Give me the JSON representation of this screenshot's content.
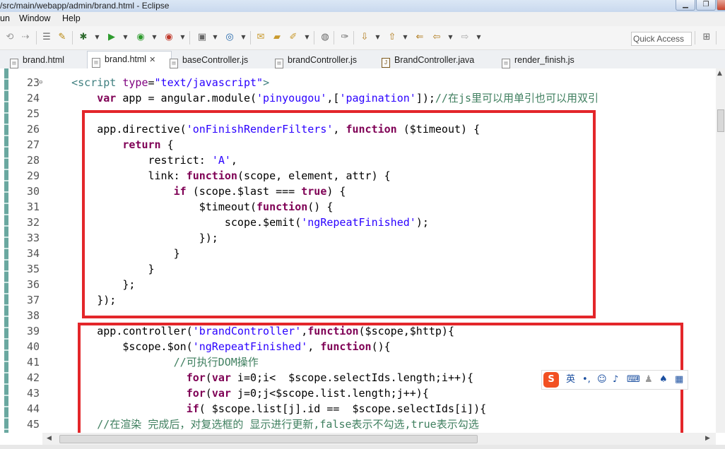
{
  "window": {
    "title": "/src/main/webapp/admin/brand.html - Eclipse"
  },
  "menu": [
    "un",
    "Window",
    "Help"
  ],
  "quick_access": "Quick Access",
  "tabs": [
    {
      "label": "brand.html"
    },
    {
      "label": "brand.html",
      "close": "✕",
      "active": true
    },
    {
      "label": "baseController.js"
    },
    {
      "label": "brandController.js"
    },
    {
      "label": "BrandController.java"
    },
    {
      "label": "render_finish.js"
    }
  ],
  "ime": {
    "logo": "S",
    "label": "英"
  },
  "code_lines": [
    {
      "n": "23",
      "fold": "⊖",
      "code": [
        [
          "tag",
          "<"
        ],
        [
          "tag",
          "script "
        ],
        [
          "att",
          "type"
        ],
        [
          "",
          "="
        ],
        [
          "str",
          "\"text/javascript\""
        ],
        [
          "tag",
          ">"
        ]
      ],
      "indent": "    "
    },
    {
      "n": "24",
      "code": [
        [
          "kw",
          "var"
        ],
        [
          "",
          " app = angular.module("
        ],
        [
          "str",
          "'pinyougou'"
        ],
        [
          "",
          ",["
        ],
        [
          "str",
          "'pagination'"
        ],
        [
          "",
          "]);"
        ],
        [
          "com",
          "//在js里可以用单引也可以用双引"
        ]
      ],
      "indent": "        "
    },
    {
      "n": "25",
      "code": [],
      "indent": ""
    },
    {
      "n": "26",
      "code": [
        [
          "",
          "app.directive("
        ],
        [
          "str",
          "'onFinishRenderFilters'"
        ],
        [
          "",
          ", "
        ],
        [
          "kw",
          "function"
        ],
        [
          "",
          " ($timeout) {"
        ]
      ],
      "indent": "        "
    },
    {
      "n": "27",
      "code": [
        [
          "kw",
          "return"
        ],
        [
          "",
          " {"
        ]
      ],
      "indent": "            "
    },
    {
      "n": "28",
      "code": [
        [
          "",
          "restrict: "
        ],
        [
          "str",
          "'A'"
        ],
        [
          "",
          ","
        ]
      ],
      "indent": "                "
    },
    {
      "n": "29",
      "code": [
        [
          "",
          "link: "
        ],
        [
          "kw",
          "function"
        ],
        [
          "",
          "(scope, element, attr) {"
        ]
      ],
      "indent": "                "
    },
    {
      "n": "30",
      "code": [
        [
          "kw",
          "if"
        ],
        [
          "",
          " (scope.$last === "
        ],
        [
          "kw",
          "true"
        ],
        [
          "",
          ") {"
        ]
      ],
      "indent": "                    "
    },
    {
      "n": "31",
      "code": [
        [
          "",
          "$timeout("
        ],
        [
          "kw",
          "function"
        ],
        [
          "",
          "() {"
        ]
      ],
      "indent": "                        "
    },
    {
      "n": "32",
      "code": [
        [
          "",
          "scope.$emit("
        ],
        [
          "str",
          "'ngRepeatFinished'"
        ],
        [
          "",
          ");"
        ]
      ],
      "indent": "                            "
    },
    {
      "n": "33",
      "code": [
        [
          "",
          "});"
        ]
      ],
      "indent": "                        "
    },
    {
      "n": "34",
      "code": [
        [
          "",
          "}"
        ]
      ],
      "indent": "                    "
    },
    {
      "n": "35",
      "code": [
        [
          "",
          "}"
        ]
      ],
      "indent": "                "
    },
    {
      "n": "36",
      "code": [
        [
          "",
          "};"
        ]
      ],
      "indent": "            "
    },
    {
      "n": "37",
      "code": [
        [
          "",
          "});"
        ]
      ],
      "indent": "        "
    },
    {
      "n": "38",
      "code": [],
      "indent": ""
    },
    {
      "n": "39",
      "code": [
        [
          "",
          "app.controller("
        ],
        [
          "str",
          "'brandController'"
        ],
        [
          "",
          ","
        ],
        [
          "kw",
          "function"
        ],
        [
          "",
          "($scope,$http){"
        ]
      ],
      "indent": "        "
    },
    {
      "n": "40",
      "code": [
        [
          "",
          "$scope.$on("
        ],
        [
          "str",
          "'ngRepeatFinished'"
        ],
        [
          "",
          ", "
        ],
        [
          "kw",
          "function"
        ],
        [
          "",
          "(){"
        ]
      ],
      "indent": "            "
    },
    {
      "n": "41",
      "code": [
        [
          "com",
          "//可执行DOM操作"
        ]
      ],
      "indent": "                    "
    },
    {
      "n": "42",
      "code": [
        [
          "kw",
          "for"
        ],
        [
          "",
          "("
        ],
        [
          "kw",
          "var"
        ],
        [
          "",
          " i=0;i<  $scope.selectIds.length;i++){"
        ]
      ],
      "indent": "                      "
    },
    {
      "n": "43",
      "code": [
        [
          "kw",
          "for"
        ],
        [
          "",
          "("
        ],
        [
          "kw",
          "var"
        ],
        [
          "",
          " j=0;j<$scope.list.length;j++){"
        ]
      ],
      "indent": "                      "
    },
    {
      "n": "44",
      "code": [
        [
          "kw",
          "if"
        ],
        [
          "",
          "( $scope.list[j].id ==  $scope.selectIds[i]){"
        ]
      ],
      "indent": "                      "
    },
    {
      "n": "45",
      "code": [
        [
          "com",
          "//在渲染 完成后，对复选框的 显示进行更新,false表示不勾选,true表示勾选"
        ]
      ],
      "indent": "        "
    }
  ]
}
